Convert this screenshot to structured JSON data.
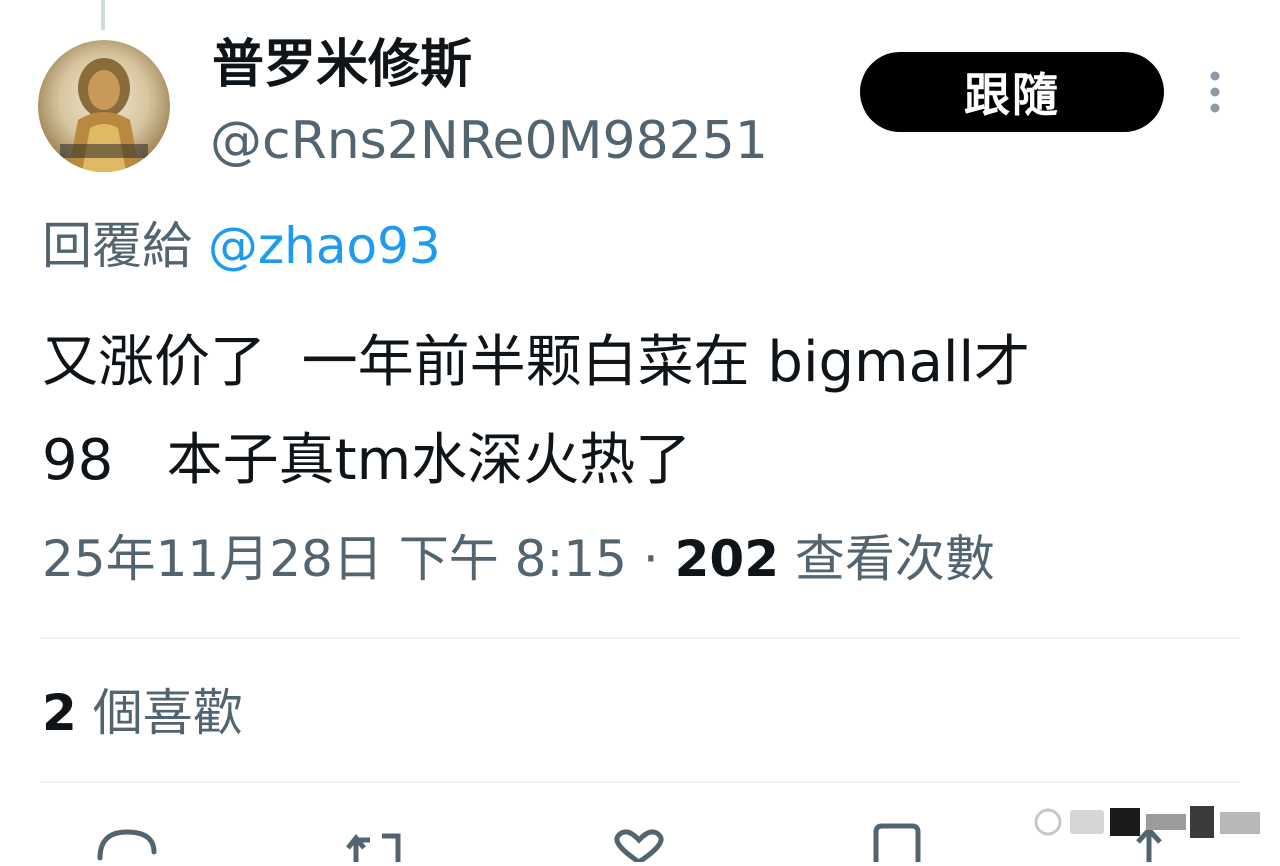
{
  "author": {
    "display_name": "普罗米修斯",
    "handle": "@cRns2NRe0M98251",
    "avatar": "avatar-image"
  },
  "follow_button": {
    "label": "跟隨"
  },
  "more_icon": "more-vertical-icon",
  "reply": {
    "prefix": "回覆給 ",
    "handle": "@zhao93"
  },
  "tweet": {
    "lines": [
      "又涨价了  一年前半颗白菜在 bigmall才",
      "98   本子真tm水深火热了"
    ]
  },
  "meta": {
    "timestamp": "25年11月28日 下午 8:15",
    "separator": " · ",
    "views_count": "202",
    "views_label": " 查看次數"
  },
  "likes": {
    "count": "2",
    "label": " 個喜歡"
  },
  "actions": [
    "reply-icon",
    "retweet-icon",
    "like-icon",
    "bookmark-icon",
    "share-icon"
  ],
  "colors": {
    "accent": "#1d9bf0",
    "secondary_text": "#536471",
    "primary_text": "#0f1419",
    "divider": "#eff3f4",
    "button_bg": "#000000"
  }
}
